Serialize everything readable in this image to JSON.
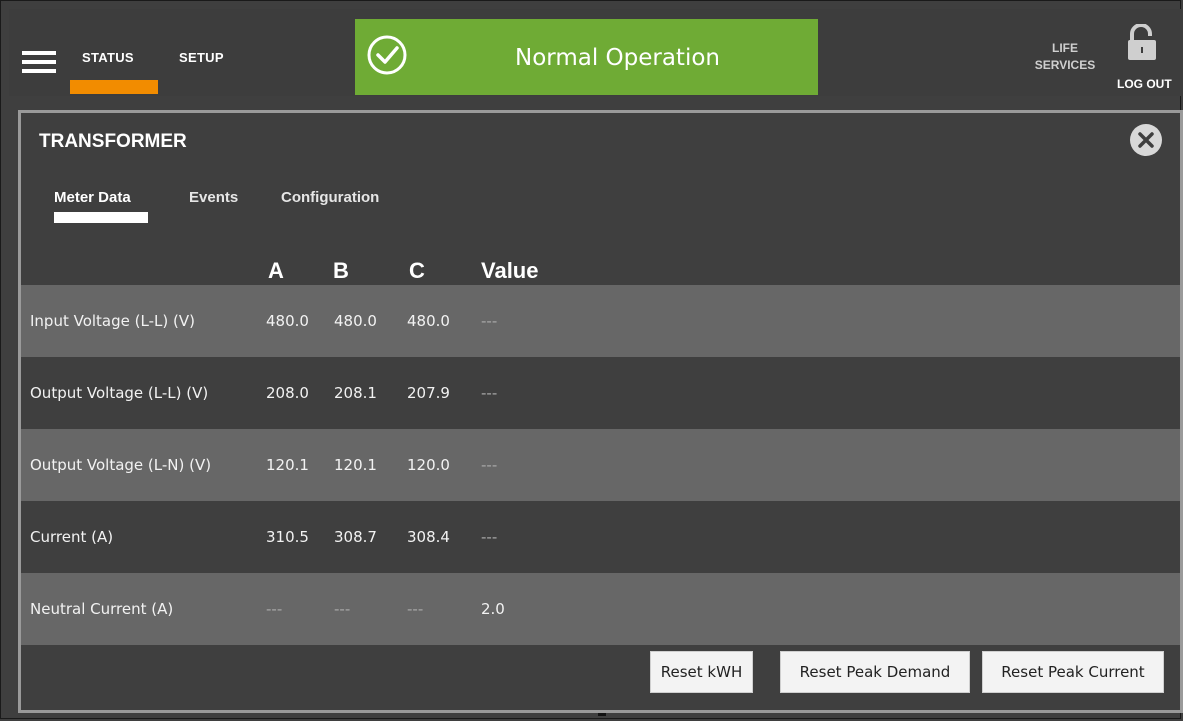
{
  "header": {
    "nav": [
      {
        "label": "STATUS"
      },
      {
        "label": "SETUP"
      }
    ],
    "status": {
      "text": "Normal Operation",
      "color": "#6fab35"
    },
    "life_services": "LIFE SERVICES",
    "logout": "LOG OUT",
    "accent": "#f28c00"
  },
  "panel": {
    "title": "TRANSFORMER",
    "tabs": [
      {
        "label": "Meter Data",
        "active": true
      },
      {
        "label": "Events"
      },
      {
        "label": "Configuration"
      }
    ],
    "columns": [
      "A",
      "B",
      "C",
      "Value"
    ],
    "rows": [
      {
        "label": "Input Voltage (L-L) (V)",
        "a": "480.0",
        "b": "480.0",
        "c": "480.0",
        "value": "---"
      },
      {
        "label": "Output Voltage (L-L) (V)",
        "a": "208.0",
        "b": "208.1",
        "c": "207.9",
        "value": "---"
      },
      {
        "label": "Output Voltage (L-N) (V)",
        "a": "120.1",
        "b": "120.1",
        "c": "120.0",
        "value": "---"
      },
      {
        "label": "Current (A)",
        "a": "310.5",
        "b": "308.7",
        "c": "308.4",
        "value": "---"
      },
      {
        "label": "Neutral Current (A)",
        "a": "---",
        "b": "---",
        "c": "---",
        "value": "2.0"
      }
    ],
    "buttons": {
      "reset_kwh": "Reset kWH",
      "reset_peak_demand": "Reset Peak Demand",
      "reset_peak_current": "Reset Peak Current"
    }
  },
  "icons": {
    "menu": "hamburger-menu-icon",
    "status": "check-circle-icon",
    "lock": "unlocked-padlock-icon",
    "close": "close-circle-icon"
  }
}
